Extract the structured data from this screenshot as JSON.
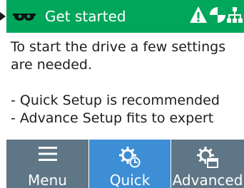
{
  "header": {
    "title": "Get started",
    "icons": [
      "glasses-icon",
      "warning-icon",
      "maintenance-icon",
      "network-icon"
    ],
    "bg_color": "#00a65a"
  },
  "content": {
    "intro": "To start the drive a few settings are needed.",
    "lines": [
      "- Quick Setup is recommended",
      "- Advance Setup fits to expert"
    ]
  },
  "nav": {
    "menu_label": "Menu",
    "quick_label": "Quick",
    "advanced_label": "Advanced",
    "selected": "Quick",
    "active_color": "#3d8ed4",
    "inactive_color": "#5e7685"
  }
}
